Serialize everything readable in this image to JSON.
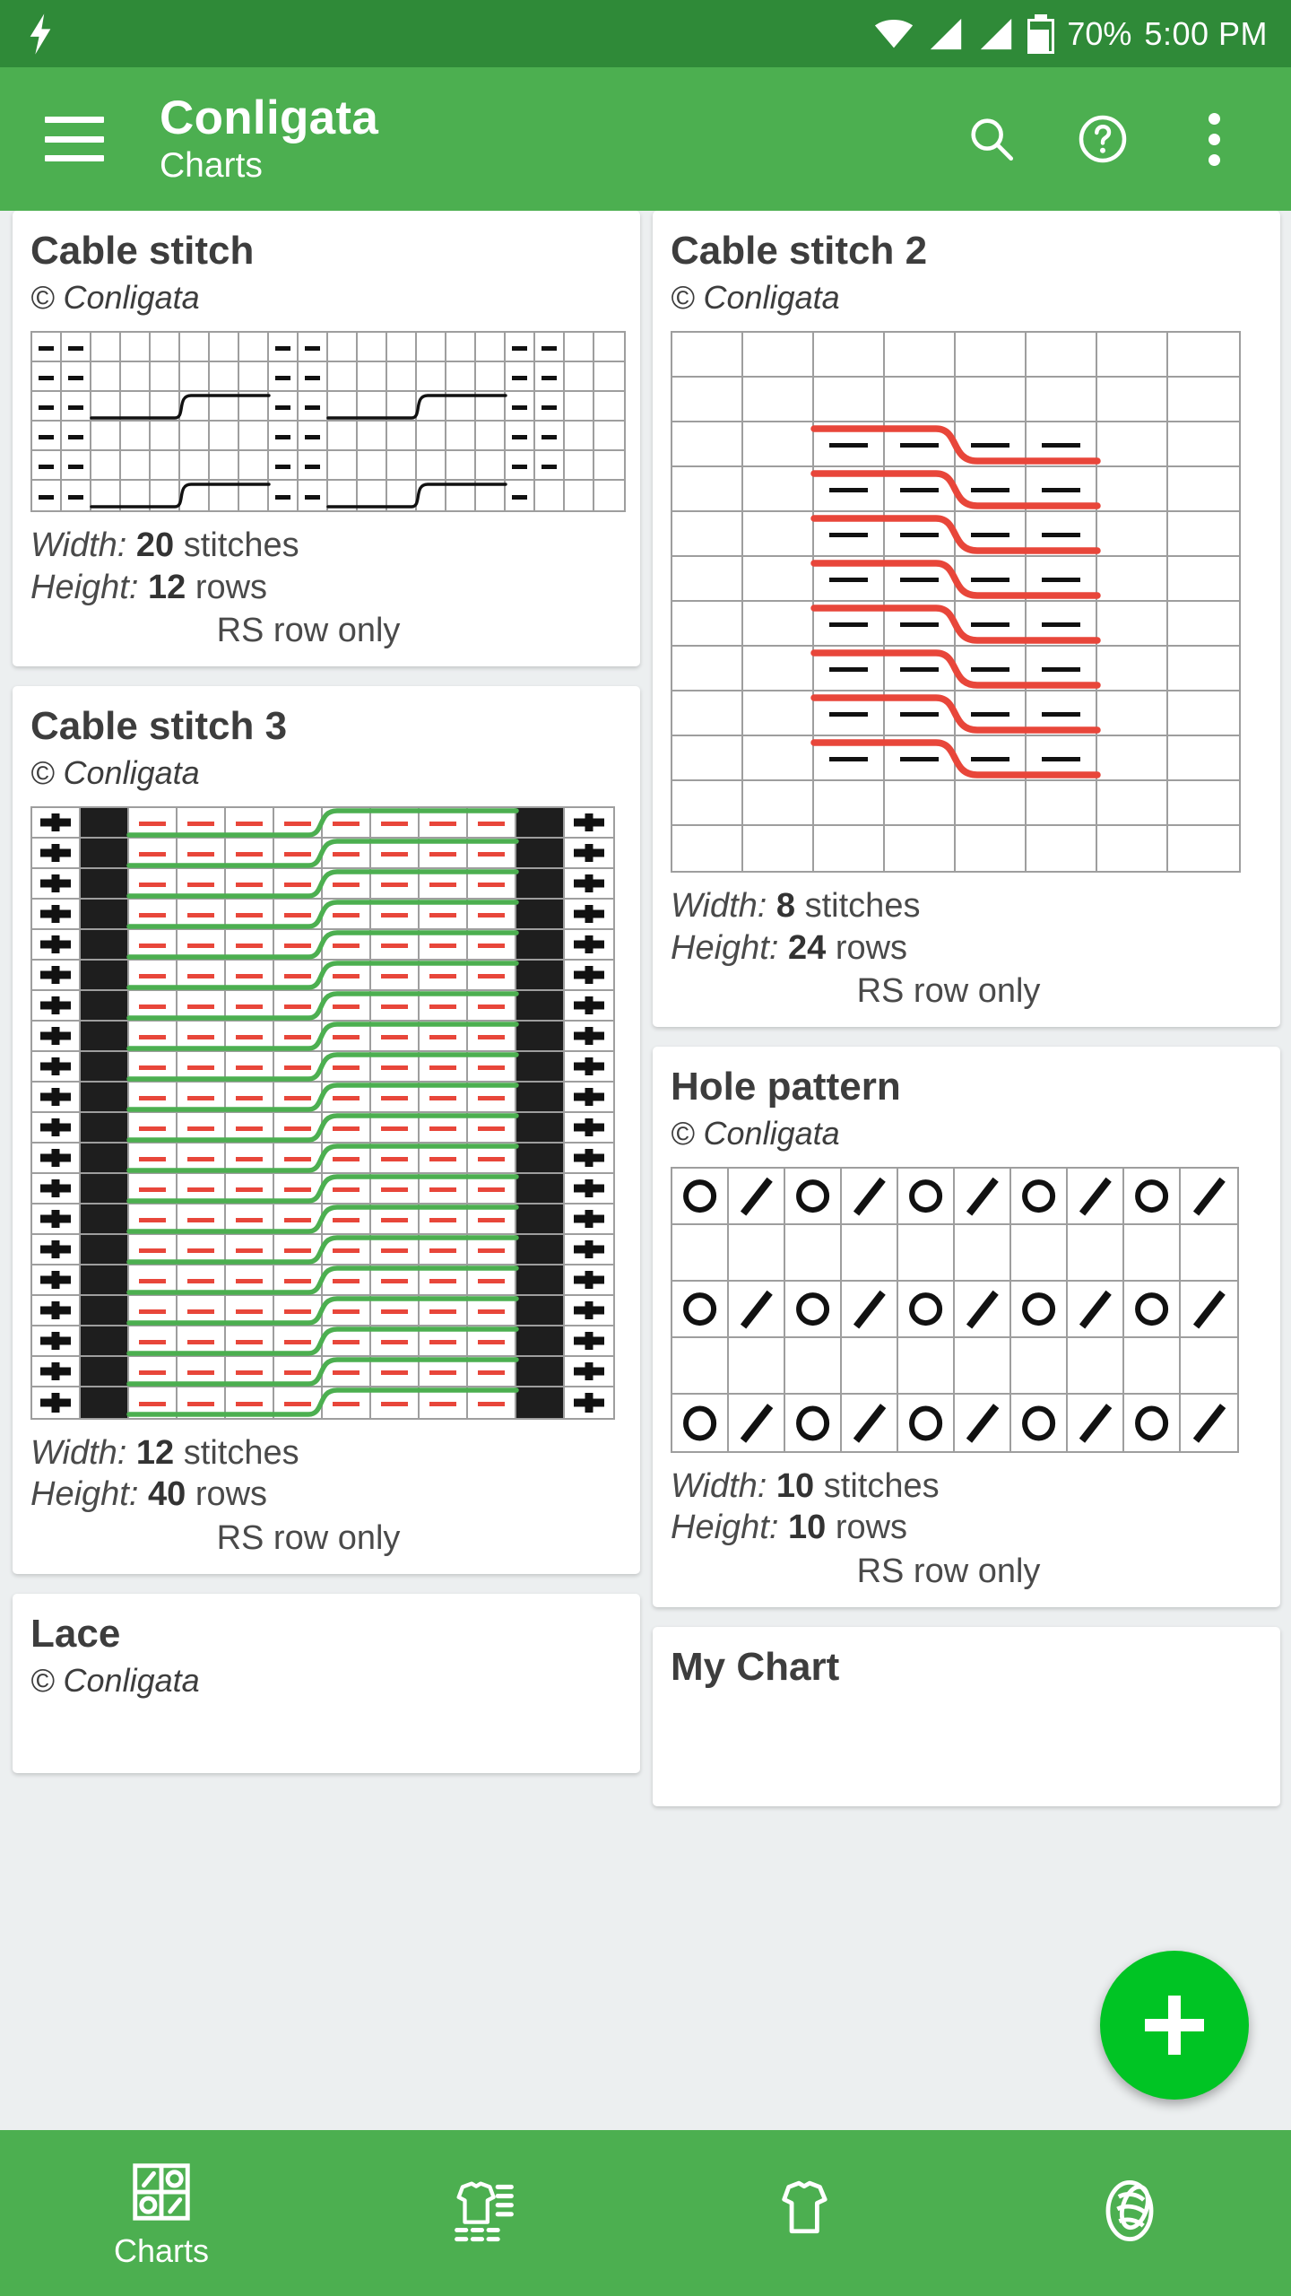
{
  "statusbar": {
    "bolt_icon": "lightning-bolt-icon",
    "wifi_icon": "wifi-icon",
    "signal_icon_1": "signal-icon",
    "signal_icon_2": "signal-icon",
    "battery_icon": "battery-icon",
    "battery_level": "70%",
    "time": "5:00 PM"
  },
  "appbar": {
    "menu_icon": "hamburger-menu-icon",
    "title": "Conligata",
    "subtitle": "Charts",
    "search_icon": "search-icon",
    "help_icon": "help-circle-icon",
    "overflow_icon": "overflow-menu-icon",
    "accent_color": "#4caf50",
    "statusbar_color": "#2f8a38"
  },
  "fab": {
    "label": "+",
    "name": "add-chart-fab",
    "color": "#00c424"
  },
  "bottom_nav": {
    "items": [
      {
        "label": "Charts",
        "icon": "charts-grid-icon",
        "active": true
      },
      {
        "label": "",
        "icon": "garment-measurements-icon",
        "active": false
      },
      {
        "label": "",
        "icon": "garment-icon",
        "active": false
      },
      {
        "label": "",
        "icon": "yarn-ball-icon",
        "active": false
      }
    ]
  },
  "labels": {
    "width_prefix": "Width:",
    "width_unit": "stitches",
    "height_prefix": "Height:",
    "height_unit": "rows",
    "rs_row_only": "RS row only",
    "copyright": "© Conligata"
  },
  "chart_data": {
    "type": "table",
    "title": "Knitting chart library",
    "charts": [
      {
        "name": "Cable stitch",
        "copyright": "© Conligata",
        "width": "20",
        "height": "12",
        "rs_note": "RS row only",
        "grid": {
          "cols": 20,
          "visible_rows": 6,
          "cell": 34
        },
        "purl_color": "#111111",
        "cable_color": "#111111",
        "purl_columns": [
          1,
          2,
          9,
          10,
          17,
          18
        ],
        "cable_rows": [
          3,
          6
        ],
        "cables": [
          {
            "row": 3,
            "from_col": 3,
            "to_col": 8
          },
          {
            "row": 3,
            "from_col": 11,
            "to_col": 16
          },
          {
            "row": 6,
            "from_col": 3,
            "to_col": 8
          },
          {
            "row": 6,
            "from_col": 11,
            "to_col": 16
          }
        ]
      },
      {
        "name": "Cable stitch 2",
        "copyright": "© Conligata",
        "width": "8",
        "height": "24",
        "rs_note": "RS row only",
        "grid": {
          "cols": 8,
          "visible_rows": 12,
          "cell": 80
        },
        "purl_color": "#111111",
        "cable_color": "#e8463a",
        "purl_columns": [
          3,
          4,
          5,
          6
        ],
        "cable_rows": [
          3,
          4,
          5,
          6,
          7,
          8,
          9,
          10
        ],
        "blank_rows": [
          1,
          2,
          11,
          12
        ]
      },
      {
        "name": "Cable stitch 3",
        "copyright": "© Conligata",
        "width": "12",
        "height": "40",
        "rs_note": "RS row only",
        "grid": {
          "cols": 12,
          "visible_rows": 20,
          "cell": 55
        },
        "purl_color": "#e8463a",
        "cable_color": "#4caf50",
        "plus_columns": [
          1,
          12
        ],
        "black_columns": [
          2,
          11
        ],
        "purl_columns": [
          3,
          4,
          5,
          6,
          7,
          8,
          9,
          10
        ],
        "cable_cross_col": 6
      },
      {
        "name": "Hole pattern",
        "copyright": "© Conligata",
        "width": "10",
        "height": "10",
        "rs_note": "RS row only",
        "grid": {
          "cols": 10,
          "visible_rows": 5,
          "cell": 63
        },
        "symbol_rows": [
          1,
          3,
          5
        ],
        "blank_rows": [
          2,
          4
        ],
        "row_pattern": [
          "O",
          "/",
          "O",
          "/",
          "O",
          "/",
          "O",
          "/",
          "O",
          "/"
        ]
      },
      {
        "name": "Lace",
        "copyright": "© Conligata",
        "width": "",
        "height": "",
        "rs_note": "",
        "partial": true
      },
      {
        "name": "My Chart",
        "copyright": "",
        "width": "",
        "height": "",
        "rs_note": "",
        "partial": true
      }
    ]
  }
}
